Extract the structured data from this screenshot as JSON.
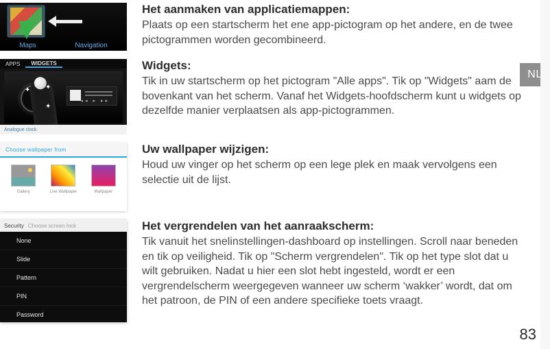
{
  "lang_tab": "NL",
  "page_number": "83",
  "sections": {
    "s1": {
      "title": "Het aanmaken van applicatiemappen:",
      "body": "Plaats op een startscherm het ene app-pictogram op het andere, en de twee pictogrammen worden gecombineerd."
    },
    "s2": {
      "title": "Widgets:",
      "body": "Tik in uw startscherm op het pictogram \"Alle apps\". Tik op \"Widgets\" aam de bovenkant van het scherm. Vanaf het Widgets-hoofdscherm kunt u widgets op dezelfde manier verplaatsen als app-pictogrammen."
    },
    "s3": {
      "title": "Uw wallpaper wijzigen:",
      "body": "Houd uw vinger op het scherm op een lege plek en maak vervolgens een selectie uit de lijst."
    },
    "s4": {
      "title": "Het vergrendelen van het aanraakscherm:",
      "body": "Tik vanuit het snelinstellingen-dashboard op instellingen. Scroll naar beneden en tik op veiligheid. Tik op \"Scherm vergrendelen\". Tik op het type slot dat u wilt gebruiken. Nadat u hier een slot hebt ingesteld, wordt er een vergrendelscherm weergegeven wanneer uw scherm ‘wakker’ wordt, dat om het patroon, de PIN of een andere specifieke toets vraagt."
    }
  },
  "thumbs": {
    "t1": {
      "label_left": "Maps",
      "label_right": "Navigation"
    },
    "t2": {
      "tab_apps": "APPS",
      "tab_widgets": "WIDGETS",
      "caption": "Analogue clock",
      "controls": "◂◂ ▸ ▸▸"
    },
    "t3": {
      "header": "Choose wallpaper from",
      "opt1": "Gallery",
      "opt2": "Live Wallpaper",
      "opt3": "Wallpaper"
    },
    "t4": {
      "header_main": "Security",
      "header_sub": "Choose screen lock",
      "items": [
        "None",
        "Slide",
        "Pattern",
        "PIN",
        "Password"
      ]
    }
  }
}
